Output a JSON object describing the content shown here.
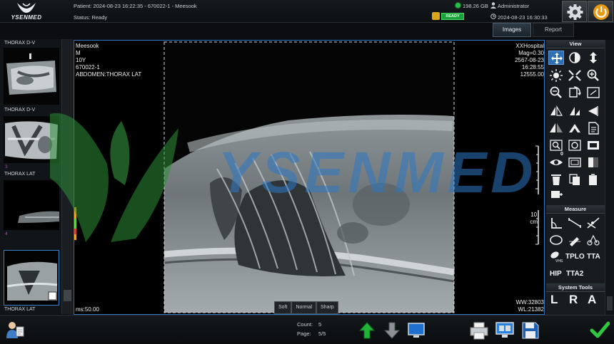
{
  "app": {
    "logo_text": "YSENMED"
  },
  "header": {
    "patient": "Patient: 2024-08-23 16:22:35 - 670022-1 - Meesook",
    "status": "Status: Ready",
    "disk": "198.26 GB",
    "user": "Administrator",
    "ready_badge": "READY",
    "datetime": "2024-08-23 16:30:33"
  },
  "tabs": [
    {
      "label": "Images",
      "active": true
    },
    {
      "label": "Report",
      "active": false
    }
  ],
  "thumbnails": [
    {
      "label": "THORAX D-V",
      "number": ""
    },
    {
      "label": "THORAX D-V",
      "number": "3"
    },
    {
      "label": "THORAX LAT",
      "number": "4"
    },
    {
      "label": "THORAX LAT",
      "number": ""
    }
  ],
  "viewer": {
    "overlay_left": [
      "Meesook",
      "M",
      "10Y",
      "670022-1",
      "ABDOMEN:THORAX LAT"
    ],
    "overlay_right": [
      "XXHospital",
      "Mag=0.30",
      "2567-08-23",
      "16:28:55",
      "12555.00"
    ],
    "scale_value": "10",
    "scale_unit": "cm",
    "ms": "ms:50.00",
    "ww": "WW:32803",
    "wl": "WL:21382",
    "filters": [
      "Soft",
      "Normal",
      "Sharp"
    ]
  },
  "tools": {
    "view_header": "View",
    "measure_header": "Measure",
    "system_header": "System Tools",
    "eye_count": "0",
    "text_tools": [
      "TPLO",
      "TTA",
      "HIP",
      "TTA2"
    ],
    "letter_tools": [
      "L",
      "R",
      "A"
    ]
  },
  "footer": {
    "count": "Count:",
    "count_value": "5",
    "page": "Page:",
    "page_value": "5/5"
  },
  "colors": {
    "accent": "#2d78c4",
    "ready": "#1aa23a",
    "watermark_green": "#2f8f3a",
    "watermark_blue": "#2d78c4"
  }
}
